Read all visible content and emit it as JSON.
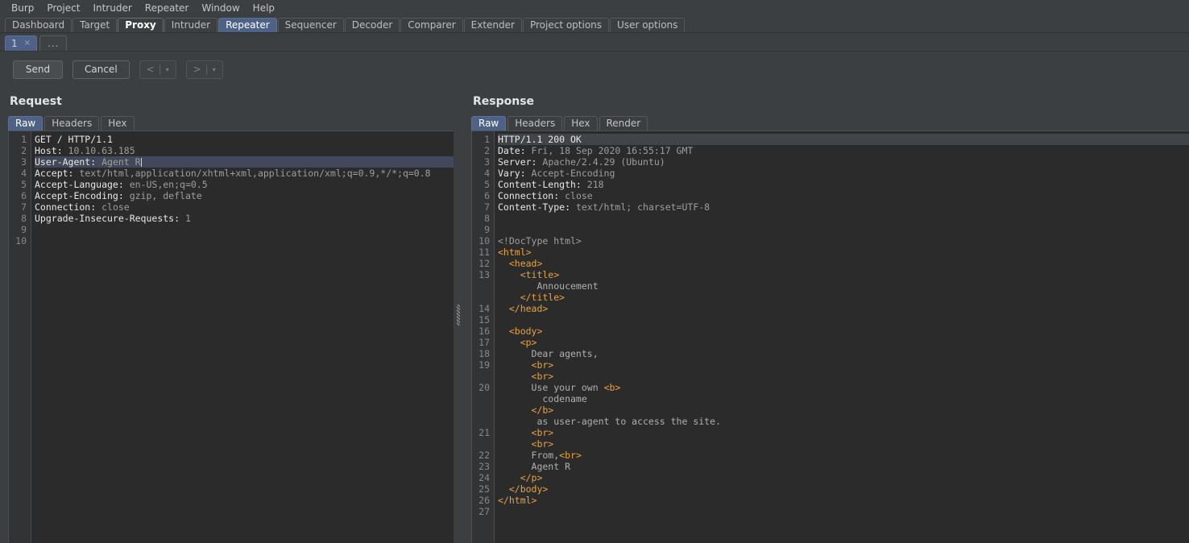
{
  "menubar": {
    "items": [
      "Burp",
      "Project",
      "Intruder",
      "Repeater",
      "Window",
      "Help"
    ]
  },
  "main_tabs": [
    {
      "label": "Dashboard",
      "state": "normal"
    },
    {
      "label": "Target",
      "state": "normal"
    },
    {
      "label": "Proxy",
      "state": "bold"
    },
    {
      "label": "Intruder",
      "state": "normal"
    },
    {
      "label": "Repeater",
      "state": "active"
    },
    {
      "label": "Sequencer",
      "state": "normal"
    },
    {
      "label": "Decoder",
      "state": "normal"
    },
    {
      "label": "Comparer",
      "state": "normal"
    },
    {
      "label": "Extender",
      "state": "normal"
    },
    {
      "label": "Project options",
      "state": "normal"
    },
    {
      "label": "User options",
      "state": "normal"
    }
  ],
  "repeater_tabs": {
    "active_label": "1",
    "close_glyph": "×",
    "add_label": "..."
  },
  "toolbar": {
    "send_label": "Send",
    "cancel_label": "Cancel",
    "back_label": "<",
    "forward_label": ">",
    "separator": "|",
    "caret": "▾"
  },
  "request": {
    "title": "Request",
    "tabs": [
      "Raw",
      "Headers",
      "Hex"
    ],
    "active_tab": "Raw",
    "line_numbers": [
      "1",
      "2",
      "3",
      "4",
      "5",
      "6",
      "7",
      "8",
      "9",
      "10"
    ],
    "lines": [
      {
        "n": "1",
        "highlight": false,
        "parts": [
          {
            "t": "GET / HTTP/1.1",
            "c": "k"
          }
        ]
      },
      {
        "n": "2",
        "highlight": false,
        "parts": [
          {
            "t": "Host: ",
            "c": "k"
          },
          {
            "t": "10.10.63.185",
            "c": "v"
          }
        ]
      },
      {
        "n": "3",
        "highlight": true,
        "caret": true,
        "parts": [
          {
            "t": "User-Agent: ",
            "c": "k"
          },
          {
            "t": "Agent R",
            "c": "v"
          }
        ]
      },
      {
        "n": "4",
        "highlight": false,
        "parts": [
          {
            "t": "Accept: ",
            "c": "k"
          },
          {
            "t": "text/html,application/xhtml+xml,application/xml;q=0.9,*/*;q=0.8",
            "c": "v"
          }
        ]
      },
      {
        "n": "5",
        "highlight": false,
        "parts": [
          {
            "t": "Accept-Language: ",
            "c": "k"
          },
          {
            "t": "en-US,en;q=0.5",
            "c": "v"
          }
        ]
      },
      {
        "n": "6",
        "highlight": false,
        "parts": [
          {
            "t": "Accept-Encoding: ",
            "c": "k"
          },
          {
            "t": "gzip, deflate",
            "c": "v"
          }
        ]
      },
      {
        "n": "7",
        "highlight": false,
        "parts": [
          {
            "t": "Connection: ",
            "c": "k"
          },
          {
            "t": "close",
            "c": "v"
          }
        ]
      },
      {
        "n": "8",
        "highlight": false,
        "parts": [
          {
            "t": "Upgrade-Insecure-Requests: ",
            "c": "k"
          },
          {
            "t": "1",
            "c": "v"
          }
        ]
      },
      {
        "n": "9",
        "highlight": false,
        "parts": []
      },
      {
        "n": "10",
        "highlight": false,
        "parts": []
      }
    ]
  },
  "response": {
    "title": "Response",
    "tabs": [
      "Raw",
      "Headers",
      "Hex",
      "Render"
    ],
    "active_tab": "Raw",
    "lines": [
      {
        "n": "1",
        "highlight": true,
        "parts": [
          {
            "t": "HTTP/1.1 200 OK",
            "c": "k"
          }
        ]
      },
      {
        "n": "2",
        "highlight": false,
        "parts": [
          {
            "t": "Date: ",
            "c": "k"
          },
          {
            "t": "Fri, 18 Sep 2020 16:55:17 GMT",
            "c": "v"
          }
        ]
      },
      {
        "n": "3",
        "highlight": false,
        "parts": [
          {
            "t": "Server: ",
            "c": "k"
          },
          {
            "t": "Apache/2.4.29 (Ubuntu)",
            "c": "v"
          }
        ]
      },
      {
        "n": "4",
        "highlight": false,
        "parts": [
          {
            "t": "Vary: ",
            "c": "k"
          },
          {
            "t": "Accept-Encoding",
            "c": "v"
          }
        ]
      },
      {
        "n": "5",
        "highlight": false,
        "parts": [
          {
            "t": "Content-Length: ",
            "c": "k"
          },
          {
            "t": "218",
            "c": "v"
          }
        ]
      },
      {
        "n": "6",
        "highlight": false,
        "parts": [
          {
            "t": "Connection: ",
            "c": "k"
          },
          {
            "t": "close",
            "c": "v"
          }
        ]
      },
      {
        "n": "7",
        "highlight": false,
        "parts": [
          {
            "t": "Content-Type: ",
            "c": "k"
          },
          {
            "t": "text/html; charset=UTF-8",
            "c": "v"
          }
        ]
      },
      {
        "n": "8",
        "highlight": false,
        "parts": []
      },
      {
        "n": "9",
        "highlight": false,
        "parts": []
      },
      {
        "n": "10",
        "highlight": false,
        "parts": [
          {
            "t": "<!DocType html>",
            "c": "v"
          }
        ]
      },
      {
        "n": "11",
        "highlight": false,
        "parts": [
          {
            "t": "<html>",
            "c": "tag"
          }
        ]
      },
      {
        "n": "12",
        "highlight": false,
        "parts": [
          {
            "t": "  <head>",
            "c": "tag"
          }
        ]
      },
      {
        "n": "13",
        "highlight": false,
        "parts": [
          {
            "t": "    <title>",
            "c": "tag"
          }
        ]
      },
      {
        "n": "",
        "highlight": false,
        "parts": [
          {
            "t": "       Annoucement",
            "c": "txt"
          }
        ]
      },
      {
        "n": "",
        "highlight": false,
        "parts": [
          {
            "t": "    </title>",
            "c": "tag"
          }
        ]
      },
      {
        "n": "14",
        "highlight": false,
        "parts": [
          {
            "t": "  </head>",
            "c": "tag"
          }
        ]
      },
      {
        "n": "15",
        "highlight": false,
        "parts": []
      },
      {
        "n": "16",
        "highlight": false,
        "parts": [
          {
            "t": "  <body>",
            "c": "tag"
          }
        ]
      },
      {
        "n": "17",
        "highlight": false,
        "parts": [
          {
            "t": "    <p>",
            "c": "tag"
          }
        ]
      },
      {
        "n": "18",
        "highlight": false,
        "parts": [
          {
            "t": "      Dear agents,",
            "c": "txt"
          }
        ]
      },
      {
        "n": "19",
        "highlight": false,
        "parts": [
          {
            "t": "      <br>",
            "c": "tag"
          }
        ]
      },
      {
        "n": "",
        "highlight": false,
        "parts": [
          {
            "t": "      <br>",
            "c": "tag"
          }
        ]
      },
      {
        "n": "20",
        "highlight": false,
        "parts": [
          {
            "t": "      Use your own ",
            "c": "txt"
          },
          {
            "t": "<b>",
            "c": "tag"
          }
        ]
      },
      {
        "n": "",
        "highlight": false,
        "parts": [
          {
            "t": "        codename",
            "c": "txt"
          }
        ]
      },
      {
        "n": "",
        "highlight": false,
        "parts": [
          {
            "t": "      </b>",
            "c": "tag"
          }
        ]
      },
      {
        "n": "",
        "highlight": false,
        "parts": [
          {
            "t": "       as user-agent to access the site.",
            "c": "txt"
          }
        ]
      },
      {
        "n": "21",
        "highlight": false,
        "parts": [
          {
            "t": "      <br>",
            "c": "tag"
          }
        ]
      },
      {
        "n": "",
        "highlight": false,
        "parts": [
          {
            "t": "      <br>",
            "c": "tag"
          }
        ]
      },
      {
        "n": "22",
        "highlight": false,
        "parts": [
          {
            "t": "      From,",
            "c": "txt"
          },
          {
            "t": "<br>",
            "c": "tag"
          }
        ]
      },
      {
        "n": "23",
        "highlight": false,
        "parts": [
          {
            "t": "      Agent R",
            "c": "txt"
          }
        ]
      },
      {
        "n": "24",
        "highlight": false,
        "parts": [
          {
            "t": "    </p>",
            "c": "tag"
          }
        ]
      },
      {
        "n": "25",
        "highlight": false,
        "parts": [
          {
            "t": "  </body>",
            "c": "tag"
          }
        ]
      },
      {
        "n": "26",
        "highlight": false,
        "parts": [
          {
            "t": "</html>",
            "c": "tag"
          }
        ]
      },
      {
        "n": "27",
        "highlight": false,
        "parts": []
      }
    ]
  }
}
